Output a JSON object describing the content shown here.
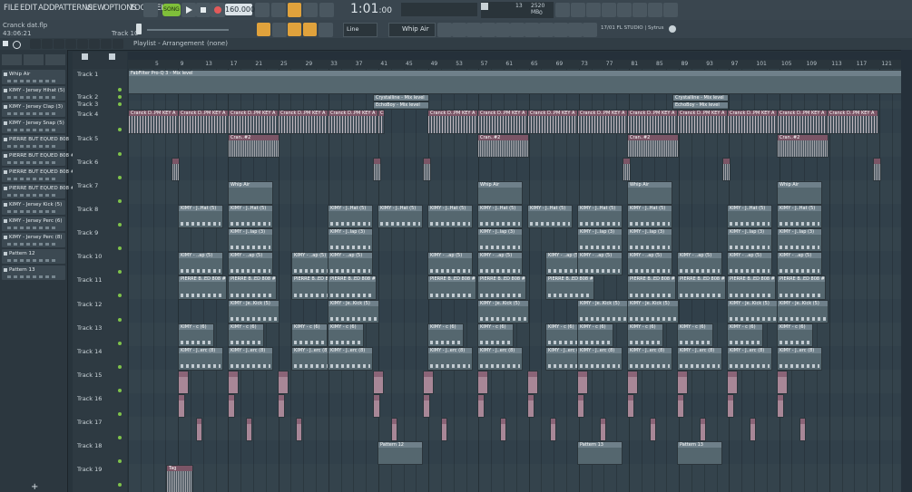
{
  "menu": [
    "FILE",
    "EDIT",
    "ADD",
    "PATTERNS",
    "VIEW",
    "OPTIONS",
    "TOOLS",
    "HELP"
  ],
  "transport": {
    "mode": "SONG",
    "tempo": "160.000",
    "time": "1:01",
    "subtime": ":00",
    "cpu": "13",
    "mem": "2520 MB",
    "polyphony": "0"
  },
  "project": {
    "filename": "Cranck dat.flp",
    "time": "43:06:21",
    "hint_track": "Track 10"
  },
  "tools": {
    "snap": "Line",
    "pattern_selector": "Whip Air",
    "plugin_info": "17/01 FL STUDIO | Sytrus"
  },
  "playlist": {
    "breadcrumb": "Playlist - Arrangement",
    "arrangement": "(none)"
  },
  "patterns": [
    "Whip Air",
    "KIMY - Jersey Hihat (5)",
    "KIMY - Jersey Clap (3)",
    "KIMY - Jersey Snap (5)",
    "PIERRE BUT EQUED 808",
    "PIERRE BUT EQUED 808 #4",
    "PIERRE BUT EQUED 808 #2",
    "PIERRE BUT EQUED 808 #3",
    "KIMY - Jersey Kick (5)",
    "KIMY - Jersey Perc (6)",
    "KIMY - Jersey Perc (8)",
    "Pattern 12",
    "Pattern 13"
  ],
  "ruler": [
    "5",
    "9",
    "13",
    "17",
    "21",
    "25",
    "29",
    "33",
    "37",
    "41",
    "45",
    "49",
    "53",
    "57",
    "61",
    "65",
    "69",
    "73",
    "77",
    "81",
    "85",
    "89",
    "93",
    "97",
    "101",
    "105",
    "109",
    "113",
    "117",
    "121"
  ],
  "tracks": [
    "Track 1",
    "Track 2",
    "Track 3",
    "Track 4",
    "Track 5",
    "Track 6",
    "Track 7",
    "Track 8",
    "Track 9",
    "Track 10",
    "Track 11",
    "Track 12",
    "Track 13",
    "Track 14",
    "Track 15",
    "Track 16",
    "Track 17",
    "Track 18",
    "Track 19"
  ],
  "clip_labels": {
    "automation": "FabFilter Pro-Q 3 - Mix level",
    "crystalline": "Crystalline - Mix level",
    "echoboy": "EchoBoy - Mix level",
    "cranck": "Cranck D..PM KEY A",
    "cran": "Cran..#2",
    "whip": "Whip Air",
    "hihat": "KIMY - J..Hat (5)",
    "clap": "KIMY - J..lap (3)",
    "snap": "KIMY - ..ap (5)",
    "pierre": "PIERRE B..ED 808 #4",
    "kick": "KIMY - Je..Kick (5)",
    "perc6": "KIMY - c (6)",
    "perc8": "KIMY - J..erc (8)",
    "pattern12": "Pattern 12",
    "pattern13": "Pattern 13",
    "tag": "Tag"
  }
}
